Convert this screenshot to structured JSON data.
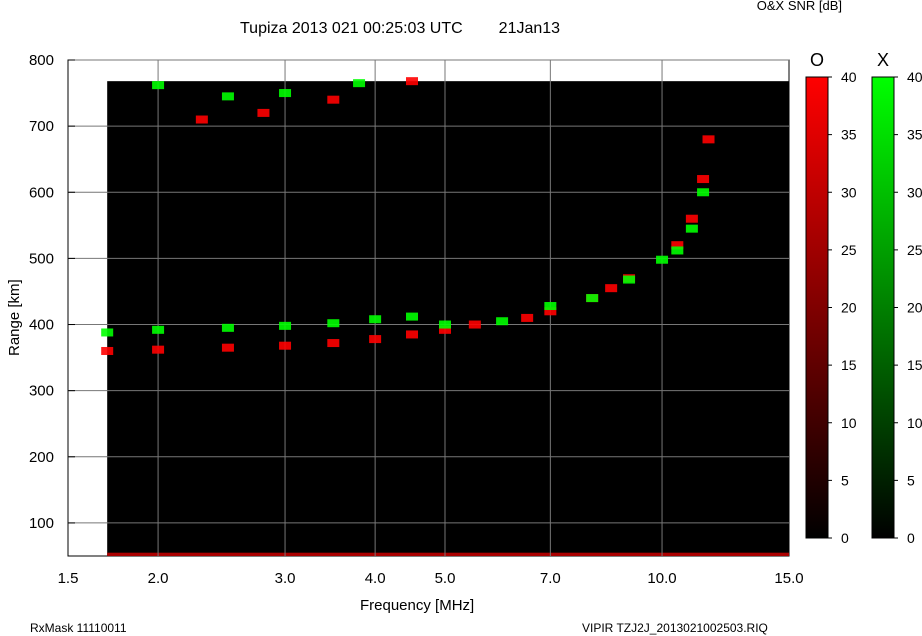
{
  "header": {
    "title": "Tupiza 2013 021 00:25:03 UTC",
    "date": "21Jan13",
    "snr_label": "O&X SNR [dB]"
  },
  "footer": {
    "left": "RxMask 11110011",
    "right": "VIPIR  TZJ2J_2013021002503.RIQ"
  },
  "colorbars": [
    {
      "letter": "O",
      "color": "#ff0000",
      "ticks": [
        "40",
        "35",
        "30",
        "25",
        "20",
        "15",
        "10",
        "5",
        "0"
      ]
    },
    {
      "letter": "X",
      "color": "#00ff00",
      "ticks": [
        "40",
        "35",
        "30",
        "25",
        "20",
        "15",
        "10",
        "5",
        "0"
      ]
    }
  ],
  "chart_data": {
    "type": "scatter",
    "title": "Tupiza 2013 021 00:25:03 UTC",
    "xlabel": "Frequency [MHz]",
    "ylabel": "Range [km]",
    "x_scale": "log",
    "xlim": [
      1.5,
      15.0
    ],
    "ylim": [
      50,
      800
    ],
    "x_ticks": [
      1.5,
      2.0,
      3.0,
      4.0,
      5.0,
      7.0,
      10.0,
      15.0
    ],
    "x_tick_labels": [
      "1.5",
      "2.0",
      "3.0",
      "4.0",
      "5.0",
      "7.0",
      "10.0",
      "15.0"
    ],
    "y_ticks": [
      100,
      200,
      300,
      400,
      500,
      600,
      700,
      800
    ],
    "y_tick_labels": [
      "100",
      "200",
      "300",
      "400",
      "500",
      "600",
      "700",
      "800"
    ],
    "grid": true,
    "series": [
      {
        "name": "O",
        "color": "#ff0000",
        "points": [
          [
            1.7,
            360
          ],
          [
            2.0,
            362
          ],
          [
            2.5,
            365
          ],
          [
            3.0,
            368
          ],
          [
            3.5,
            372
          ],
          [
            4.0,
            378
          ],
          [
            4.5,
            385
          ],
          [
            5.0,
            392
          ],
          [
            5.5,
            400
          ],
          [
            6.5,
            410
          ],
          [
            7.0,
            420
          ],
          [
            8.0,
            440
          ],
          [
            8.5,
            455
          ],
          [
            9.0,
            470
          ],
          [
            10.5,
            520
          ],
          [
            11.0,
            560
          ],
          [
            11.4,
            620
          ],
          [
            11.6,
            680
          ],
          [
            2.3,
            710
          ],
          [
            2.8,
            720
          ],
          [
            3.5,
            740
          ],
          [
            4.5,
            768
          ]
        ]
      },
      {
        "name": "X",
        "color": "#00ff00",
        "points": [
          [
            1.7,
            388
          ],
          [
            2.0,
            392
          ],
          [
            2.5,
            395
          ],
          [
            3.0,
            398
          ],
          [
            3.5,
            402
          ],
          [
            4.0,
            408
          ],
          [
            4.5,
            412
          ],
          [
            5.0,
            400
          ],
          [
            6.0,
            405
          ],
          [
            7.0,
            428
          ],
          [
            8.0,
            440
          ],
          [
            9.0,
            468
          ],
          [
            10.0,
            498
          ],
          [
            10.5,
            512
          ],
          [
            11.0,
            545
          ],
          [
            11.4,
            600
          ],
          [
            2.0,
            762
          ],
          [
            2.5,
            745
          ],
          [
            3.0,
            750
          ],
          [
            3.8,
            765
          ]
        ]
      }
    ]
  }
}
